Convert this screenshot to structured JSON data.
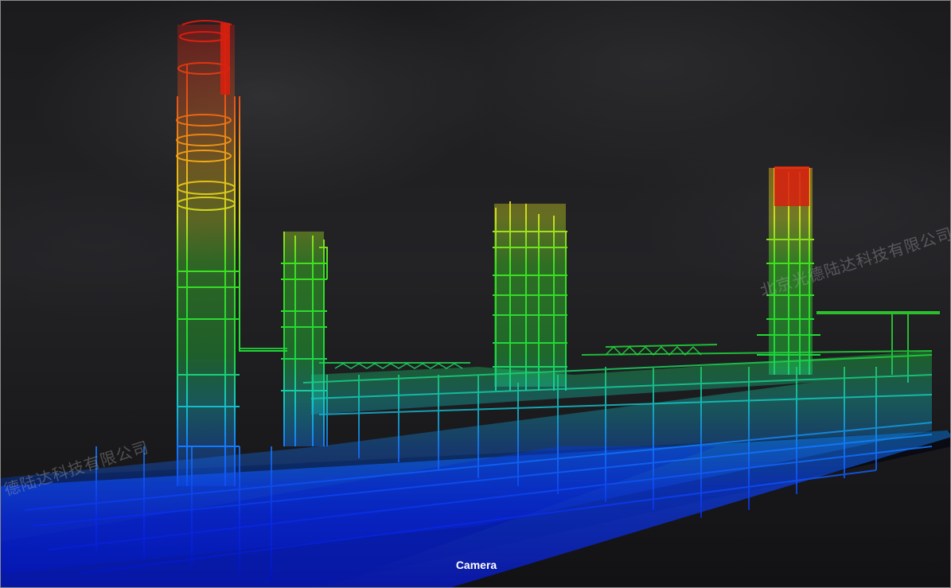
{
  "viewport": {
    "watermark_right": "北京光德陆达科技有限公司",
    "watermark_left": "德陆达科技有限公司",
    "camera_label": "Camera"
  },
  "colors": {
    "low": "#0a1fe0",
    "mid_low": "#14b8c8",
    "mid": "#1fd63a",
    "mid_high": "#d8e21a",
    "high": "#e0241a"
  }
}
